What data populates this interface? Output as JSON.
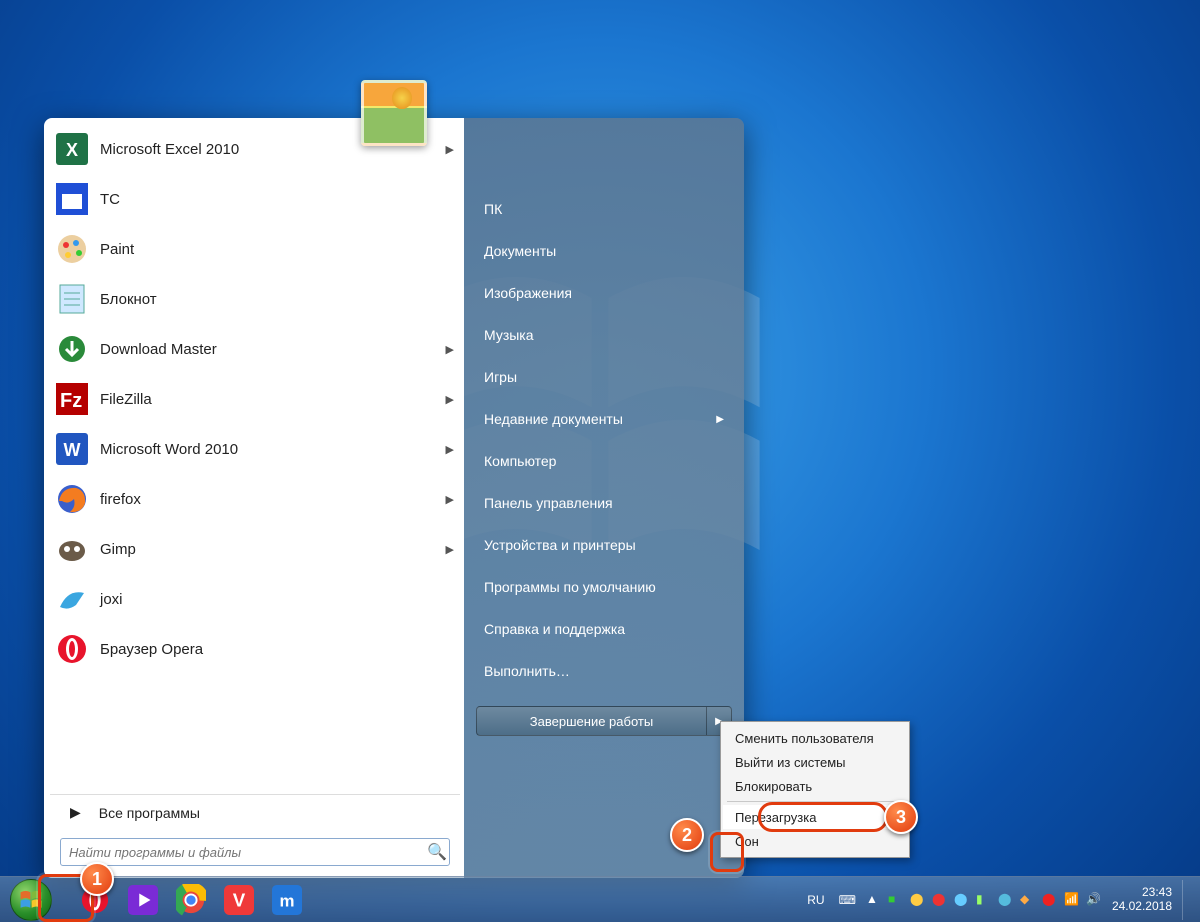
{
  "programs": [
    {
      "label": "Microsoft Excel 2010",
      "arrow": true,
      "icon": "excel"
    },
    {
      "label": "TC",
      "arrow": false,
      "icon": "tc"
    },
    {
      "label": "Paint",
      "arrow": false,
      "icon": "paint"
    },
    {
      "label": "Блокнот",
      "arrow": false,
      "icon": "notepad"
    },
    {
      "label": "Download Master",
      "arrow": true,
      "icon": "dm"
    },
    {
      "label": "FileZilla",
      "arrow": true,
      "icon": "filezilla"
    },
    {
      "label": "Microsoft Word 2010",
      "arrow": true,
      "icon": "word"
    },
    {
      "label": "firefox",
      "arrow": true,
      "icon": "firefox"
    },
    {
      "label": "Gimp",
      "arrow": true,
      "icon": "gimp"
    },
    {
      "label": "joxi",
      "arrow": false,
      "icon": "joxi"
    },
    {
      "label": "Браузер Opera",
      "arrow": false,
      "icon": "opera"
    }
  ],
  "all_programs_label": "Все программы",
  "search_placeholder": "Найти программы и файлы",
  "right_items": [
    {
      "label": "ПК",
      "arrow": false
    },
    {
      "label": "Документы",
      "arrow": false
    },
    {
      "label": "Изображения",
      "arrow": false
    },
    {
      "label": "Музыка",
      "arrow": false
    },
    {
      "label": "Игры",
      "arrow": false
    },
    {
      "label": "Недавние документы",
      "arrow": true
    },
    {
      "label": "Компьютер",
      "arrow": false
    },
    {
      "label": "Панель управления",
      "arrow": false
    },
    {
      "label": "Устройства и принтеры",
      "arrow": false
    },
    {
      "label": "Программы по умолчанию",
      "arrow": false
    },
    {
      "label": "Справка и поддержка",
      "arrow": false
    },
    {
      "label": "Выполнить…",
      "arrow": false
    }
  ],
  "shutdown_label": "Завершение работы",
  "flyout": [
    "Сменить пользователя",
    "Выйти из системы",
    "Блокировать",
    "---",
    "Перезагрузка",
    "Сон"
  ],
  "taskbar_pins": [
    "opera",
    "play",
    "chrome",
    "vivaldi",
    "maxthon"
  ],
  "tray": {
    "lang": "RU",
    "time": "23:43",
    "date": "24.02.2018"
  },
  "markers": {
    "1": "1",
    "2": "2",
    "3": "3"
  }
}
